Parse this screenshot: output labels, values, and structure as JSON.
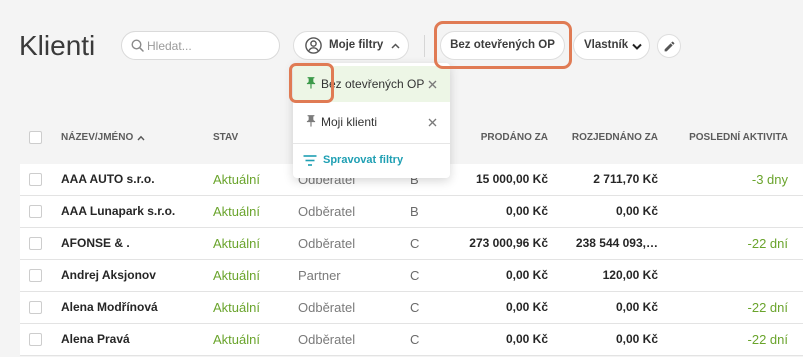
{
  "page": {
    "title": "Klienti"
  },
  "toolbar": {
    "search": {
      "icon": "search-icon",
      "placeholder": "Hledat...",
      "value": ""
    },
    "my_filters": {
      "icon": "account-circle-icon",
      "label": "Moje filtry",
      "expanded": true
    },
    "active_filter": {
      "label": "Bez otevřených OP"
    },
    "owner": {
      "label": "Vlastník",
      "icon": "chevron-down-icon"
    },
    "edit": {
      "icon": "pencil-icon"
    }
  },
  "filters_menu": {
    "items": [
      {
        "label": "Bez otevřených OP",
        "icon": "pin-icon",
        "pinned": true,
        "selected": true
      },
      {
        "label": "Moji klienti",
        "icon": "pin-icon",
        "pinned": false,
        "selected": false
      }
    ],
    "manage": {
      "label": "Spravovat filtry",
      "icon": "filter-list-icon"
    }
  },
  "table": {
    "columns": {
      "name": "NÁZEV/JMÉNO",
      "status": "STAV",
      "sold": "PRODÁNO ZA",
      "negotiated": "ROZJEDNÁNO ZA",
      "last_activity": "POSLEDNÍ AKTIVITA"
    },
    "sort": {
      "column": "name",
      "direction": "asc"
    },
    "rows": [
      {
        "name": "AAA AUTO s.r.o.",
        "status": "Aktuální",
        "type": "Odběratel",
        "category": "B",
        "sold": "15 000,00 Kč",
        "negotiated": "2 711,70 Kč",
        "last_activity": "-3 dny"
      },
      {
        "name": "AAA Lunapark s.r.o.",
        "status": "Aktuální",
        "type": "Odběratel",
        "category": "B",
        "sold": "0,00 Kč",
        "negotiated": "0,00 Kč"
      },
      {
        "name": "AFONSE & .",
        "status": "Aktuální",
        "type": "Odběratel",
        "category": "C",
        "sold": "273 000,96 Kč",
        "negotiated": "238 544 093,…",
        "last_activity": "-22 dní"
      },
      {
        "name": "Andrej Aksjonov",
        "status": "Aktuální",
        "type": "Partner",
        "category": "C",
        "sold": "0,00 Kč",
        "negotiated": "120,00 Kč"
      },
      {
        "name": "Alena Modřínová",
        "status": "Aktuální",
        "type": "Odběratel",
        "category": "C",
        "sold": "0,00 Kč",
        "negotiated": "0,00 Kč",
        "last_activity": "-22 dní"
      },
      {
        "name": "Alena Pravá",
        "status": "Aktuální",
        "type": "Odběratel",
        "category": "C",
        "sold": "0,00 Kč",
        "negotiated": "0,00 Kč",
        "last_activity": "-22 dní"
      }
    ]
  },
  "colors": {
    "status_green": "#6aa42c",
    "link_teal": "#1e9fb3",
    "pin_green": "#3c9a4a",
    "selected_filter_bg": "#edf6e6",
    "annotation_orange": "#e07b54"
  }
}
